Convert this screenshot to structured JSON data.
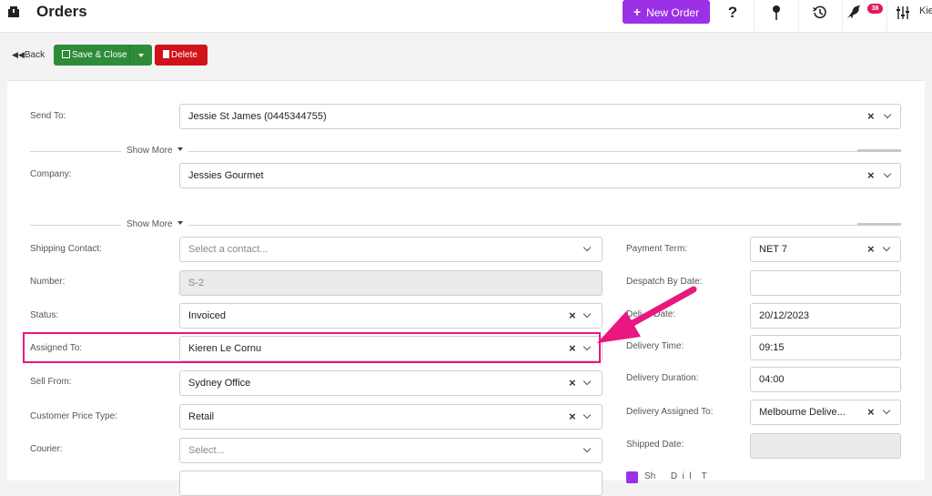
{
  "header": {
    "title": "Orders",
    "new_order_label": "New Order",
    "badge_count": "38",
    "user_truncated": "Kie"
  },
  "toolbar": {
    "back_label": "Back",
    "save_label": "Save & Close",
    "delete_label": "Delete"
  },
  "form": {
    "send_to": {
      "label": "Send To:",
      "value": "Jessie St James (0445344755)"
    },
    "show_more_1": "Show More",
    "company": {
      "label": "Company:",
      "value": "Jessies Gourmet"
    },
    "show_more_2": "Show More",
    "shipping_contact": {
      "label": "Shipping Contact:",
      "placeholder": "Select a contact..."
    },
    "number": {
      "label": "Number:",
      "value": "S-2"
    },
    "status": {
      "label": "Status:",
      "value": "Invoiced"
    },
    "assigned_to": {
      "label": "Assigned To:",
      "value": "Kieren Le Cornu"
    },
    "sell_from": {
      "label": "Sell From:",
      "value": "Sydney Office"
    },
    "customer_price_type": {
      "label": "Customer Price Type:",
      "value": "Retail"
    },
    "courier": {
      "label": "Courier:",
      "placeholder": "Select..."
    },
    "payment_term": {
      "label": "Payment Term:",
      "value": "NET 7"
    },
    "despatch_by_date": {
      "label": "Despatch By Date:",
      "value": ""
    },
    "delivery_date": {
      "label_left": "Deli",
      "label_right": "Date:",
      "value": "20/12/2023"
    },
    "delivery_time": {
      "label": "Delivery Time:",
      "value": "09:15"
    },
    "delivery_duration": {
      "label": "Delivery Duration:",
      "value": "04:00"
    },
    "delivery_assigned_to": {
      "label": "Delivery Assigned To:",
      "value": "Melbourne Delive..."
    },
    "shipped_date": {
      "label": "Shipped Date:",
      "value": ""
    },
    "bottom_checkbox_text": "Sh      D  i  l    T"
  },
  "colors": {
    "accent": "#9b30e6",
    "save_green": "#2e8b3a",
    "delete_red": "#d0121a",
    "highlight_pink": "#e9177f"
  }
}
